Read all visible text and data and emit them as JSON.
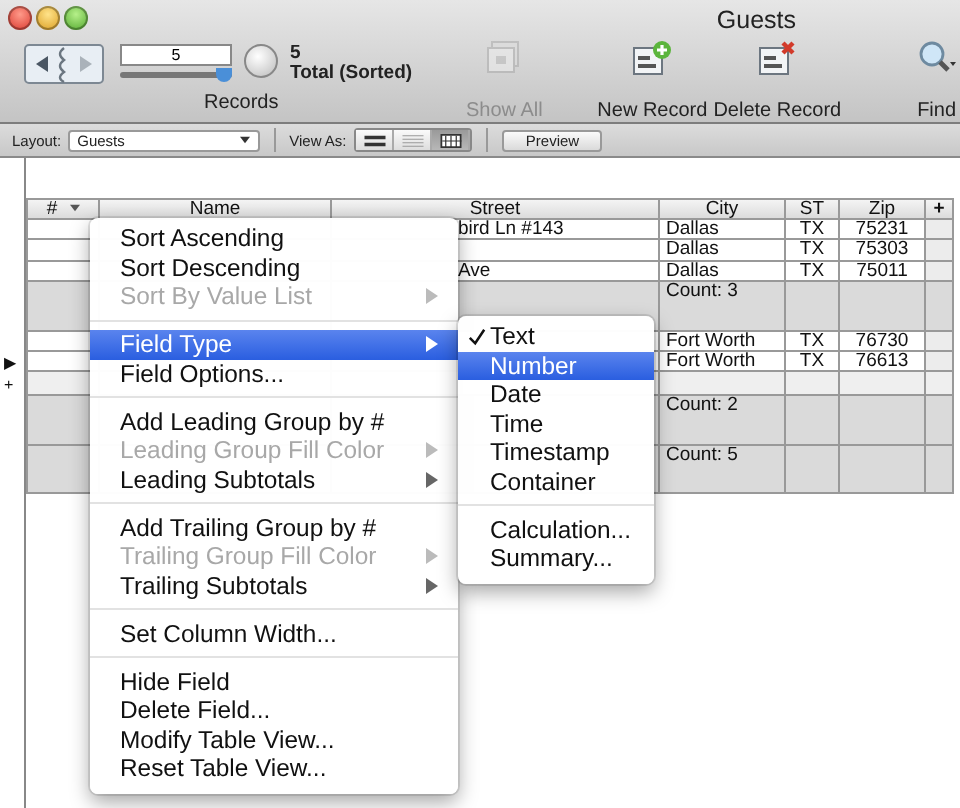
{
  "window": {
    "title": "Guests"
  },
  "toolbar": {
    "record_field": "5",
    "record_slider": {
      "level": 1
    },
    "record_count": "5",
    "record_status": "Total (Sorted)",
    "records_label": "Records",
    "buttons": [
      {
        "kind": "show-all",
        "label": "Show All",
        "disabled": true
      },
      {
        "kind": "new",
        "label": "New Record",
        "disabled": false
      },
      {
        "kind": "delete",
        "label": "Delete Record",
        "disabled": false
      },
      {
        "kind": "find",
        "label": "Find",
        "disabled": false
      }
    ]
  },
  "layout_bar": {
    "layout_label": "Layout:",
    "layout_value": "Guests",
    "view_as_label": "View As:",
    "view_modes": [
      {
        "kind": "form",
        "selected": false
      },
      {
        "kind": "list",
        "selected": false
      },
      {
        "kind": "table",
        "selected": true
      }
    ],
    "preview_button": "Preview"
  },
  "table": {
    "columns": [
      "#",
      "Name",
      "Street",
      "City",
      "ST",
      "Zip"
    ],
    "add_column": "+",
    "rows": [
      {
        "kind": "record",
        "street": "bird Ln #143",
        "city": "Dallas",
        "st": "TX",
        "zip": "75231"
      },
      {
        "kind": "record",
        "city": "Dallas",
        "st": "TX",
        "zip": "75303"
      },
      {
        "kind": "record",
        "street": "Ave",
        "city": "Dallas",
        "st": "TX",
        "zip": "75011"
      },
      {
        "kind": "subtotal",
        "city": "Count: 3"
      },
      {
        "kind": "record",
        "city": "Fort Worth",
        "st": "TX",
        "zip": "76730"
      },
      {
        "kind": "record",
        "marker": "▶",
        "city": "Fort Worth",
        "st": "TX",
        "zip": "76613"
      },
      {
        "kind": "new",
        "marker": "+"
      },
      {
        "kind": "subtotal",
        "city": "Count: 2"
      },
      {
        "kind": "subtotal",
        "city": "Count: 5"
      }
    ]
  },
  "context_menu": {
    "items": [
      {
        "kind": "item",
        "label": "Sort Ascending",
        "disabled": false,
        "selected": false,
        "submenu": false
      },
      {
        "kind": "item",
        "label": "Sort Descending",
        "disabled": false,
        "selected": false,
        "submenu": false
      },
      {
        "kind": "item",
        "label": "Sort By Value List",
        "disabled": true,
        "selected": false,
        "submenu": true
      },
      {
        "kind": "separator"
      },
      {
        "kind": "item",
        "label": "Field Type",
        "disabled": false,
        "selected": true,
        "submenu": true
      },
      {
        "kind": "item",
        "label": "Field Options...",
        "disabled": false,
        "selected": false,
        "submenu": false
      },
      {
        "kind": "separator"
      },
      {
        "kind": "item",
        "label": "Add Leading Group by #",
        "disabled": false,
        "selected": false,
        "submenu": false
      },
      {
        "kind": "item",
        "label": "Leading Group Fill Color",
        "disabled": true,
        "selected": false,
        "submenu": true
      },
      {
        "kind": "item",
        "label": "Leading Subtotals",
        "disabled": false,
        "selected": false,
        "submenu": true
      },
      {
        "kind": "separator"
      },
      {
        "kind": "item",
        "label": "Add Trailing Group by #",
        "disabled": false,
        "selected": false,
        "submenu": false
      },
      {
        "kind": "item",
        "label": "Trailing Group Fill Color",
        "disabled": true,
        "selected": false,
        "submenu": true
      },
      {
        "kind": "item",
        "label": "Trailing Subtotals",
        "disabled": false,
        "selected": false,
        "submenu": true
      },
      {
        "kind": "separator"
      },
      {
        "kind": "item",
        "label": "Set Column Width...",
        "disabled": false,
        "selected": false,
        "submenu": false
      },
      {
        "kind": "separator"
      },
      {
        "kind": "item",
        "label": "Hide Field",
        "disabled": false,
        "selected": false,
        "submenu": false
      },
      {
        "kind": "item",
        "label": "Delete Field...",
        "disabled": false,
        "selected": false,
        "submenu": false
      },
      {
        "kind": "item",
        "label": "Modify Table View...",
        "disabled": false,
        "selected": false,
        "submenu": false
      },
      {
        "kind": "item",
        "label": "Reset Table View...",
        "disabled": false,
        "selected": false,
        "submenu": false
      }
    ]
  },
  "field_type_submenu": {
    "items": [
      {
        "kind": "item",
        "label": "Text",
        "checked": true,
        "selected": false
      },
      {
        "kind": "item",
        "label": "Number",
        "checked": false,
        "selected": true
      },
      {
        "kind": "item",
        "label": "Date",
        "checked": false,
        "selected": false
      },
      {
        "kind": "item",
        "label": "Time",
        "checked": false,
        "selected": false
      },
      {
        "kind": "item",
        "label": "Timestamp",
        "checked": false,
        "selected": false
      },
      {
        "kind": "item",
        "label": "Container",
        "checked": false,
        "selected": false
      },
      {
        "kind": "separator"
      },
      {
        "kind": "item",
        "label": "Calculation...",
        "checked": false,
        "selected": false
      },
      {
        "kind": "item",
        "label": "Summary...",
        "checked": false,
        "selected": false
      }
    ]
  }
}
